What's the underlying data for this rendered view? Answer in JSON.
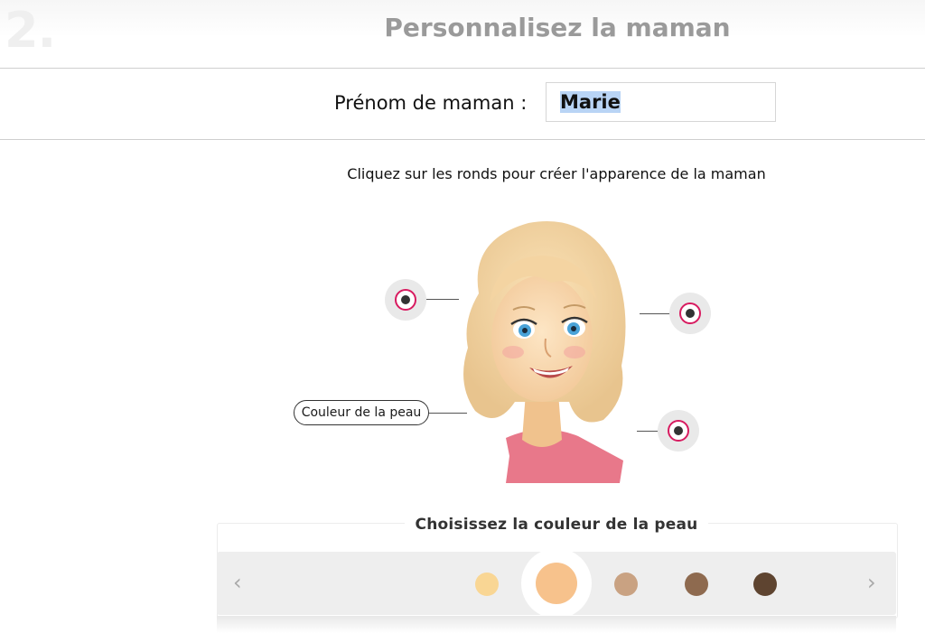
{
  "step_number": "2.",
  "section_title": "Personnalisez la maman",
  "name_field": {
    "label": "Prénom de maman :",
    "value": "Marie"
  },
  "hint_text": "Cliquez sur les ronds pour créer l'apparence de la maman",
  "hotspots": [
    {
      "label": "Couleur de la peau"
    }
  ],
  "skin_panel": {
    "title": "Choisissez la couleur de la peau",
    "prev_icon": "chevron-left-icon",
    "next_icon": "chevron-right-icon",
    "prev_glyph": "‹",
    "next_glyph": "›",
    "swatches": [
      {
        "color": "#f9d694",
        "selected": false
      },
      {
        "color": "#f7c28c",
        "selected": true
      },
      {
        "color": "#c9a282",
        "selected": false
      },
      {
        "color": "#8e6a4f",
        "selected": false
      },
      {
        "color": "#5e4430",
        "selected": false
      }
    ]
  },
  "colors": {
    "accent": "#d81b60",
    "title_gray": "#9a9a9a",
    "selection": "#b9d4f5"
  }
}
